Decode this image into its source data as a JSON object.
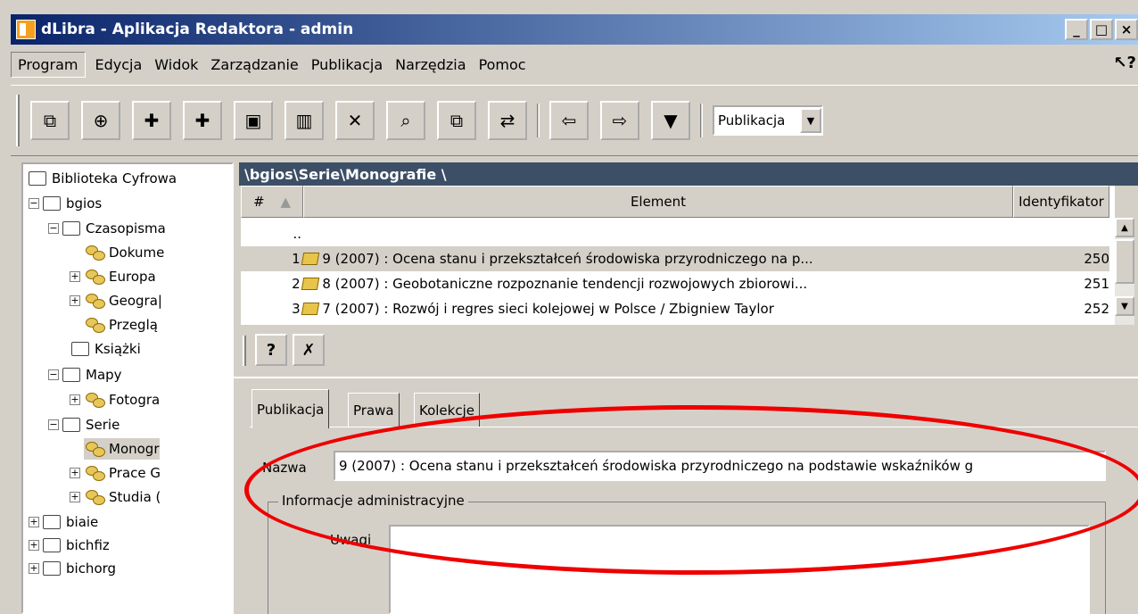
{
  "window": {
    "title": "dLibra - Aplikacja Redaktora - admin",
    "min": "_",
    "max": "□",
    "close": "×"
  },
  "menu": [
    "Program",
    "Edycja",
    "Widok",
    "Zarządzanie",
    "Publikacja",
    "Narzędzia",
    "Pomoc"
  ],
  "toolbar": {
    "combo_value": "Publikacja",
    "combo_arrow": "▼"
  },
  "tree": {
    "root": "Biblioteka Cyfrowa",
    "items": [
      {
        "label": "bgios",
        "type": "folder"
      },
      {
        "label": "Czasopisma",
        "type": "folder"
      },
      {
        "label": "Dokume",
        "type": "coins"
      },
      {
        "label": "Europa",
        "type": "coins"
      },
      {
        "label": "Geogra|",
        "type": "coins"
      },
      {
        "label": "Przeglą",
        "type": "coins"
      },
      {
        "label": "Książki",
        "type": "folder"
      },
      {
        "label": "Mapy",
        "type": "folder"
      },
      {
        "label": "Fotogra",
        "type": "coins"
      },
      {
        "label": "Serie",
        "type": "folder"
      },
      {
        "label": "Monogr",
        "type": "coins"
      },
      {
        "label": "Prace G",
        "type": "coins"
      },
      {
        "label": "Studia (",
        "type": "coins"
      },
      {
        "label": "biaie",
        "type": "folder"
      },
      {
        "label": "bichfiz",
        "type": "folder"
      },
      {
        "label": "bichorg",
        "type": "folder"
      }
    ]
  },
  "path": "\\bgios\\Serie\\Monografie \\",
  "table": {
    "headers": {
      "num": "#",
      "sort": "▲",
      "element": "Element",
      "identifier": "Identyfikator"
    },
    "parent": "..",
    "rows": [
      {
        "num": "1",
        "element": "9 (2007) : Ocena stanu i przekształceń środowiska przyrodniczego na p...",
        "id": "250"
      },
      {
        "num": "2",
        "element": "8 (2007) : Geobotaniczne rozpoznanie tendencji rozwojowych zbiorowi...",
        "id": "251"
      },
      {
        "num": "3",
        "element": "7 (2007) : Rozwój i regres sieci kolejowej w Polsce / Zbigniew Taylor",
        "id": "252"
      }
    ]
  },
  "tabs": [
    "Publikacja",
    "Prawa",
    "Kolekcje"
  ],
  "form": {
    "name_label": "Nazwa",
    "name_value": "9 (2007) : Ocena stanu i przekształceń środowiska przyrodniczego na podstawie wskaźników g",
    "group_label": "Informacje administracyjne",
    "notes_label": "Uwagi"
  },
  "annotation_color": "#ee0000"
}
